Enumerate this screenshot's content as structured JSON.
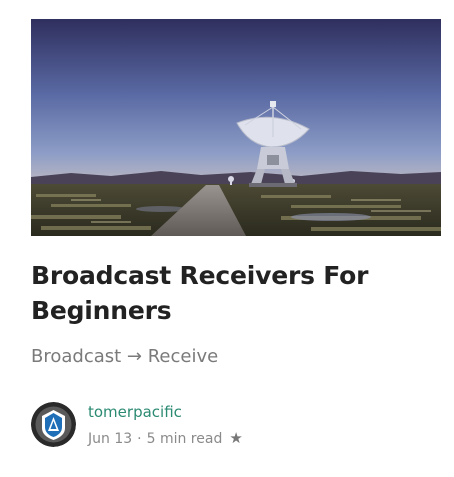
{
  "post": {
    "title": "Broadcast Receivers For Beginners",
    "subtitle": "Broadcast → Receive",
    "author": "tomerpacific",
    "date": "Jun 13",
    "separator": "·",
    "read_time": "5 min read",
    "bookmark_icon": "star-icon"
  },
  "colors": {
    "title": "#222222",
    "subtitle": "#7a7a7a",
    "author": "#2b8a72",
    "meta": "#8a8a8a"
  }
}
